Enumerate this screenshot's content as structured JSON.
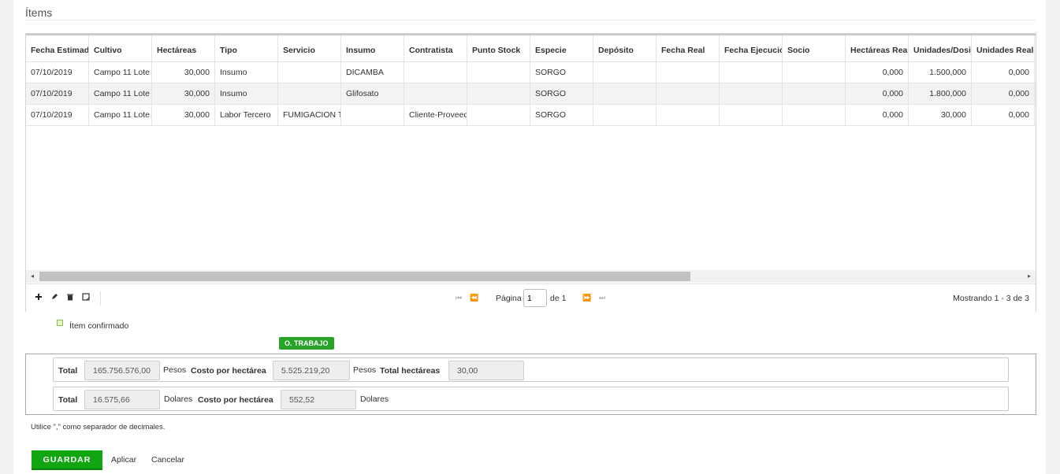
{
  "section": {
    "title": "Ítems"
  },
  "table": {
    "columns": [
      "Fecha Estimada",
      "Cultivo",
      "Hectáreas",
      "Tipo",
      "Servicio",
      "Insumo",
      "Contratista",
      "Punto Stock",
      "Especie",
      "Depósito",
      "Fecha Real",
      "Fecha Ejecución",
      "Socio",
      "Hectáreas Reales",
      "Unidades/Dosis",
      "Unidades Reales"
    ],
    "rows": [
      [
        "07/10/2019",
        "Campo 11 Lote",
        "30,000",
        "Insumo",
        "",
        "DICAMBA",
        "",
        "",
        "SORGO",
        "",
        "",
        "",
        "",
        "0,000",
        "1.500,000",
        "0,000"
      ],
      [
        "07/10/2019",
        "Campo 11 Lote",
        "30,000",
        "Insumo",
        "",
        "Glifosato",
        "",
        "",
        "SORGO",
        "",
        "",
        "",
        "",
        "0,000",
        "1.800,000",
        "0,000"
      ],
      [
        "07/10/2019",
        "Campo 11 Lote",
        "30,000",
        "Labor Tercero",
        "FUMIGACION T",
        "",
        "Cliente-Proveedor",
        "",
        "SORGO",
        "",
        "",
        "",
        "",
        "0,000",
        "30,000",
        "0,000"
      ]
    ]
  },
  "scrollbar": {
    "left_arrow": "◂",
    "right_arrow": "▸"
  },
  "toolbar": {
    "add_icon": "plus-icon",
    "edit_icon": "pencil-icon",
    "delete_icon": "trash-icon",
    "note_icon": "note-icon"
  },
  "pager": {
    "page_label": "Página",
    "page_value": "1",
    "of_label": "de 1",
    "info": "Mostrando 1 - 3 de 3"
  },
  "legend": {
    "label": "Ítem confirmado"
  },
  "badge": {
    "label": "O. TRABAJO"
  },
  "totals": {
    "row1": {
      "total_label": "Total",
      "total_value": "165.756.576,00",
      "total_unit": "Pesos",
      "cost_label": "Costo por hectárea",
      "cost_value": "5.525.219,20",
      "cost_unit": "Pesos",
      "ha_label": "Total hectáreas",
      "ha_value": "30,00"
    },
    "row2": {
      "total_label": "Total",
      "total_value": "16.575,66",
      "total_unit": "Dolares",
      "cost_label": "Costo por hectárea",
      "cost_value": "552,52",
      "cost_unit": "Dolares"
    }
  },
  "hint": "Utilice \",\" como separador de decimales.",
  "actions": {
    "save": "GUARDAR",
    "apply": "Aplicar",
    "cancel": "Cancelar"
  },
  "colors": {
    "accent_green": "#11a611",
    "badge_green": "#27a327"
  }
}
